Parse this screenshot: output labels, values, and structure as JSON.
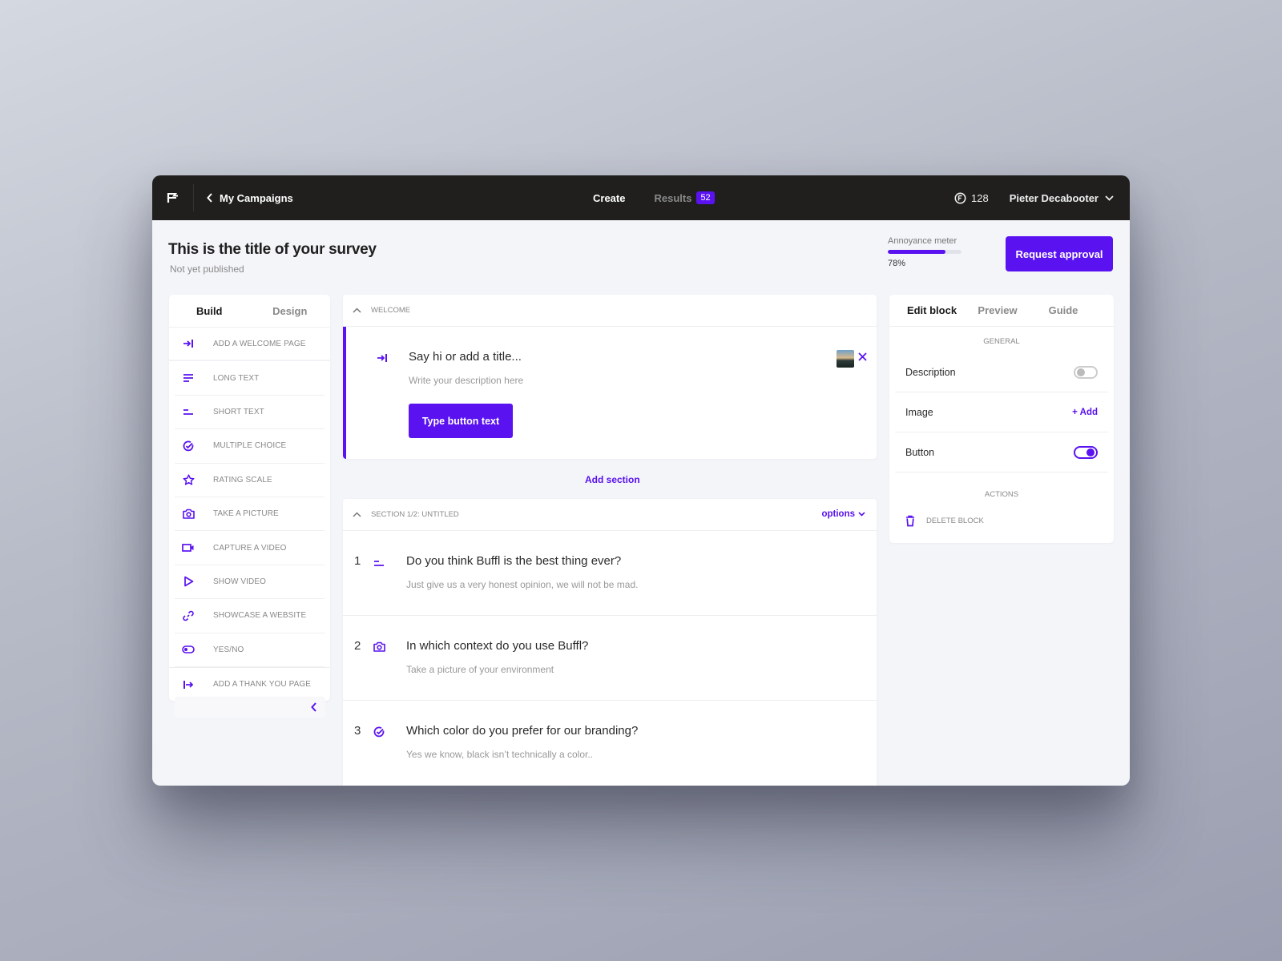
{
  "topbar": {
    "back_label": "My Campaigns",
    "nav_create": "Create",
    "nav_results": "Results",
    "results_count": "52",
    "credits": "128",
    "user_name": "Pieter Decabooter"
  },
  "header": {
    "survey_title": "This is the title of your survey",
    "status": "Not yet published",
    "meter_label": "Annoyance meter",
    "meter_value_text": "78%",
    "meter_fraction": 0.78,
    "request_label": "Request approval"
  },
  "colors": {
    "accent": "#5a12f0",
    "topbar": "#201f1e",
    "canvas": "#f4f5f9"
  },
  "left_panel": {
    "tabs": [
      {
        "label": "Build",
        "active": true
      },
      {
        "label": "Design",
        "active": false
      }
    ],
    "items": [
      {
        "label": "ADD A WELCOME PAGE",
        "icon": "welcome-icon"
      },
      {
        "label": "LONG TEXT",
        "icon": "long-text-icon"
      },
      {
        "label": "SHORT TEXT",
        "icon": "short-text-icon"
      },
      {
        "label": "MULTIPLE CHOICE",
        "icon": "check-circle-icon"
      },
      {
        "label": "RATING SCALE",
        "icon": "star-icon"
      },
      {
        "label": "TAKE A PICTURE",
        "icon": "camera-icon"
      },
      {
        "label": "CAPTURE A VIDEO",
        "icon": "video-camera-icon"
      },
      {
        "label": "SHOW VIDEO",
        "icon": "play-icon"
      },
      {
        "label": "SHOWCASE A WEBSITE",
        "icon": "link-icon"
      },
      {
        "label": "YES/NO",
        "icon": "toggle-icon"
      },
      {
        "label": "ADD A THANK YOU PAGE",
        "icon": "exit-icon"
      }
    ]
  },
  "welcome": {
    "head_label": "WELCOME",
    "title_placeholder": "Say hi or add a title...",
    "description_placeholder": "Write your description here",
    "button_placeholder": "Type button text"
  },
  "add_section_label": "Add section",
  "section": {
    "head_label": "SECTION 1/2: UNTITLED",
    "options_label": "options",
    "questions": [
      {
        "num": "1",
        "icon": "short-text-icon",
        "title": "Do you think Buffl is the best thing ever?",
        "description": "Just give us a very honest opinion, we will not be mad."
      },
      {
        "num": "2",
        "icon": "camera-icon",
        "title": "In which context do you use Buffl?",
        "description": "Take a picture of your environment"
      },
      {
        "num": "3",
        "icon": "check-circle-icon",
        "title": "Which color do you prefer for our branding?",
        "description": "Yes we know, black isn’t technically a color.."
      }
    ]
  },
  "right_panel": {
    "tabs": [
      {
        "label": "Edit block",
        "active": true
      },
      {
        "label": "Preview",
        "active": false
      },
      {
        "label": "Guide",
        "active": false
      }
    ],
    "general_label": "GENERAL",
    "rows": {
      "description_label": "Description",
      "description_on": false,
      "image_label": "Image",
      "image_action": "+ Add",
      "button_label": "Button",
      "button_on": true
    },
    "actions_label": "ACTIONS",
    "delete_label": "DELETE BLOCK"
  }
}
